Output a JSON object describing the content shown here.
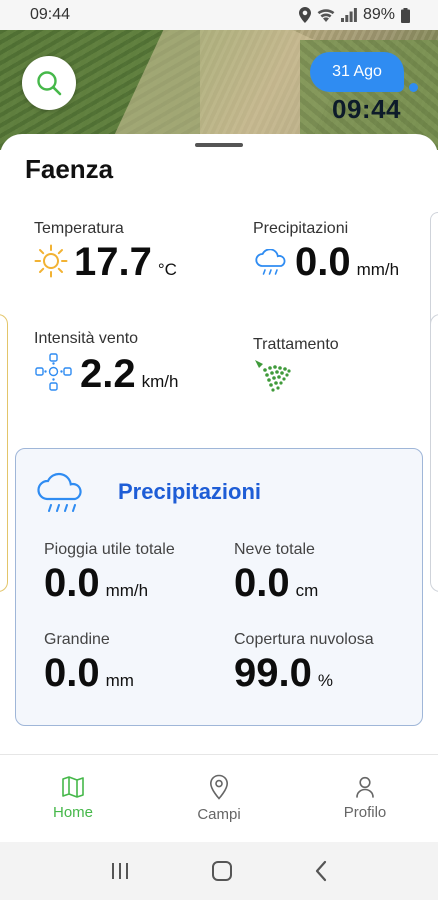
{
  "status_bar": {
    "time": "09:44",
    "battery": "89%"
  },
  "header": {
    "date": "31 Ago",
    "time": "09:44"
  },
  "location": {
    "city": "Faenza"
  },
  "weather": {
    "temperature": {
      "label": "Temperatura",
      "value": "17.7",
      "unit": "°C",
      "icon": "sun-icon"
    },
    "precipitation": {
      "label": "Precipitazioni",
      "value": "0.0",
      "unit": "mm/h",
      "icon": "rain-cloud-icon"
    },
    "wind": {
      "label": "Intensità vento",
      "value": "2.2",
      "unit": "km/h",
      "icon": "wind-icon"
    },
    "treatment": {
      "label": "Trattamento",
      "icon": "spray-icon"
    }
  },
  "precip_card": {
    "title": "Precipitazioni",
    "rain": {
      "label": "Pioggia utile totale",
      "value": "0.0",
      "unit": "mm/h"
    },
    "snow": {
      "label": "Neve totale",
      "value": "0.0",
      "unit": "cm"
    },
    "hail": {
      "label": "Grandine",
      "value": "0.0",
      "unit": "mm"
    },
    "cloud": {
      "label": "Copertura nuvolosa",
      "value": "99.0",
      "unit": "%"
    }
  },
  "nav": {
    "items": [
      {
        "label": "Home",
        "icon": "map-icon",
        "active": true
      },
      {
        "label": "Campi",
        "icon": "location-pin-icon",
        "active": false
      },
      {
        "label": "Profilo",
        "icon": "user-icon",
        "active": false
      }
    ]
  },
  "colors": {
    "accent_blue": "#2f8cf2",
    "title_blue": "#1e5dd6",
    "nav_active": "#46b84a",
    "sun": "#f2b233",
    "spray": "#3f9a3a"
  }
}
